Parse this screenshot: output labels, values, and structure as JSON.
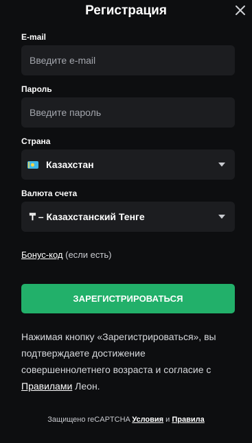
{
  "header": {
    "title": "Регистрация",
    "close_icon": "close-icon"
  },
  "form": {
    "email": {
      "label": "E-mail",
      "placeholder": "Введите e-mail",
      "value": ""
    },
    "password": {
      "label": "Пароль",
      "placeholder": "Введите пароль",
      "value": ""
    },
    "country": {
      "label": "Страна",
      "value": "Казахстан",
      "flag_icon": "kazakhstan-flag-icon"
    },
    "currency": {
      "label": "Валюта счета",
      "value": "₸ – Казахстанский Тенге"
    }
  },
  "bonus": {
    "link_label": "Бонус-код",
    "suffix": " (если есть)"
  },
  "submit": {
    "label": "ЗАРЕГИСТРИРОВАТЬСЯ"
  },
  "consent": {
    "text_before": "Нажимая кнопку «Зарегистрироваться», вы подтверждаете достижение совершеннолетнего возраста и согласие с ",
    "link_label": "Правилами",
    "text_after": " Леон."
  },
  "recaptcha": {
    "prefix": "Защищено reCAPTCHA ",
    "terms_label": "Условия",
    "and": " и ",
    "rules_label": "Правила"
  },
  "colors": {
    "background": "#0d0e10",
    "field_background": "#1c1d20",
    "primary_button": "#22b06a",
    "placeholder": "#a4a7ae"
  }
}
